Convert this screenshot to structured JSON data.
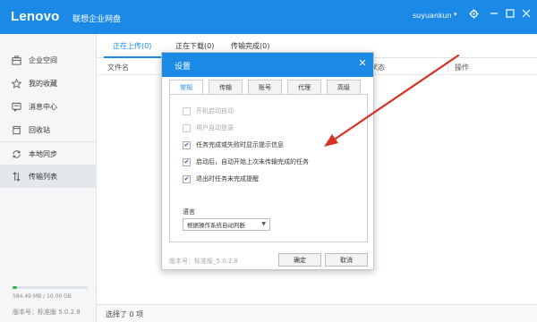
{
  "titlebar": {
    "logo": "Lenovo",
    "app_title": "联想企业网盘",
    "user": "suyuankun",
    "caret": "▾",
    "icons": [
      "gear-icon",
      "minimize-icon",
      "maximize-icon",
      "close-icon"
    ]
  },
  "sidebar": {
    "items": [
      {
        "label": "企业空间",
        "icon": "building-icon"
      },
      {
        "label": "我的收藏",
        "icon": "star-icon"
      },
      {
        "label": "消息中心",
        "icon": "message-icon"
      },
      {
        "label": "回收站",
        "icon": "trash-icon"
      },
      {
        "label": "本地同步",
        "icon": "sync-icon"
      },
      {
        "label": "传输列表",
        "icon": "transfer-icon"
      }
    ],
    "active_index": 5,
    "storage_text": "584.49 MB / 10.00 GB",
    "storage_fraction": 0.06,
    "version": "版本号：标准版 5.0.2.8"
  },
  "main": {
    "tabs": [
      "正在上传(0)",
      "正在下载(0)",
      "传输完成(0)"
    ],
    "active_tab": 0,
    "columns": {
      "name": "文件名",
      "status": "状态",
      "action": "操作"
    },
    "status_text": "选择了 0 项"
  },
  "dialog": {
    "title": "设置",
    "close": "✕",
    "tabs": [
      "常规",
      "传输",
      "账号",
      "代理",
      "高级"
    ],
    "active_tab": 0,
    "options": [
      {
        "label": "开机启动自动",
        "checked": false,
        "disabled": true
      },
      {
        "label": "用户自动登录",
        "checked": false,
        "disabled": true
      },
      {
        "label": "任务完成或失败时显示提示信息",
        "checked": true,
        "disabled": false
      },
      {
        "label": "启动后，自动开始上次未传输完成的任务",
        "checked": true,
        "disabled": false
      },
      {
        "label": "退出时任务未完成提醒",
        "checked": true,
        "disabled": false
      }
    ],
    "language_label": "语言",
    "language_value": "根据操作系统自动判断",
    "footer_version": "版本号：标准版_5.0.2.8",
    "ok": "确定",
    "cancel": "取消"
  },
  "colors": {
    "brand": "#1a8ae6",
    "annotation_arrow": "#d93025",
    "storage": "#25b84b"
  }
}
